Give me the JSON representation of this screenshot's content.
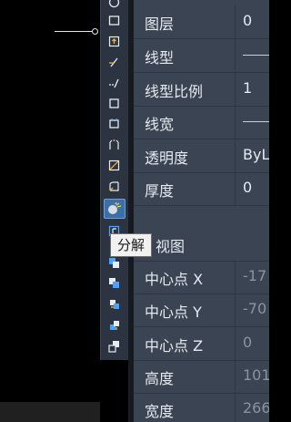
{
  "tooltip": {
    "text": "分解"
  },
  "properties": {
    "section_title": "视图",
    "rows": [
      {
        "label": "图层",
        "value": "0"
      },
      {
        "label": "线型",
        "value": ""
      },
      {
        "label": "线型比例",
        "value": "1"
      },
      {
        "label": "线宽",
        "value": ""
      },
      {
        "label": "透明度",
        "value": "ByL"
      },
      {
        "label": "厚度",
        "value": "0"
      },
      {
        "label": "中心点 X",
        "value": "-17"
      },
      {
        "label": "中心点 Y",
        "value": "-70"
      },
      {
        "label": "中心点 Z",
        "value": "0"
      },
      {
        "label": "高度",
        "value": "101"
      },
      {
        "label": "宽度",
        "value": "266"
      }
    ]
  },
  "toolbar": {
    "tools": [
      "circle-icon",
      "rectangle-icon",
      "insert-block-icon",
      "trim-icon",
      "extend-icon",
      "break-icon",
      "join-icon",
      "chamfer-icon",
      "fillet-icon",
      "blend-curves-icon",
      "explode-icon",
      "array-icon",
      "draw-order-front-icon",
      "draw-order-back-icon",
      "bring-above-icon",
      "send-under-icon",
      "text-front-icon"
    ]
  }
}
